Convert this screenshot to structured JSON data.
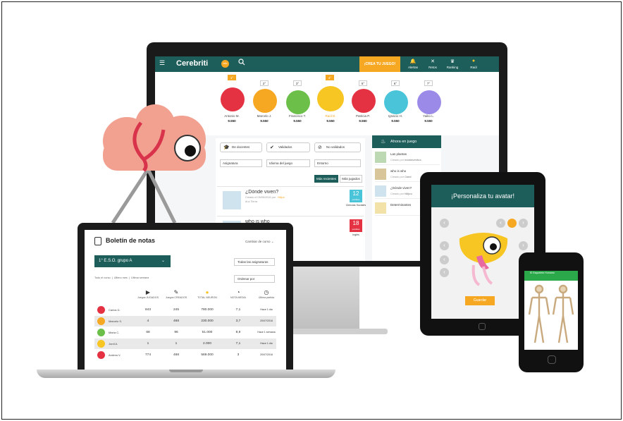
{
  "desktop": {
    "logo": "Cerebriti",
    "logo_badge": "edu",
    "create_button": "¡CREA TU JUEGO!",
    "nav": [
      {
        "label": "Alertas",
        "icon": "bell-icon"
      },
      {
        "label": "Retos",
        "icon": "swords-icon"
      },
      {
        "label": "Ranking",
        "icon": "trophy-icon"
      },
      {
        "label": "Raúl",
        "icon": "user-avatar"
      }
    ],
    "podium": [
      {
        "rank": "1°",
        "name": "Antonio M.",
        "score": "9.550",
        "color": "#e53242"
      },
      {
        "rank": "2°",
        "name": "Marcelo J.",
        "score": "9.550",
        "color": "#f7a823"
      },
      {
        "rank": "3°",
        "name": "Francisco T.",
        "score": "9.550",
        "color": "#6cc04a"
      },
      {
        "rank": "4°",
        "name": "Raúl D.",
        "score": "9.550",
        "color": "#f7c623"
      },
      {
        "rank": "5°",
        "name": "Patricia P.",
        "score": "9.550",
        "color": "#e53242"
      },
      {
        "rank": "6°",
        "name": "Ignacio H.",
        "score": "9.550",
        "color": "#4ac4d8"
      },
      {
        "rank": "7°",
        "name": "Yaiko L.",
        "score": "9.550",
        "color": "#9b8ae8"
      }
    ],
    "filters": {
      "chips": [
        {
          "label": "De docentes",
          "icon": "graduation-cap-icon"
        },
        {
          "label": "Validados",
          "icon": "check-badge-icon"
        },
        {
          "label": "No validados",
          "icon": "no-badge-icon"
        }
      ],
      "selects": [
        "Asignatura",
        "Idioma del juego",
        "Entorno"
      ],
      "tab_recent": "Más recientes",
      "tab_played": "Más jugados"
    },
    "games": [
      {
        "title": "¿Dónde viven?",
        "meta": "Creado el 05/06/2016 por",
        "author": "Ntijuo",
        "tag": "#La Tierra",
        "count": "12",
        "count_label": "partidas",
        "subject": "Ciencias Sociales",
        "badge_color": "#4ac4d8"
      },
      {
        "title": "who is who",
        "count": "18",
        "count_label": "partidas",
        "subject": "Inglés",
        "badge_color": "#e53242"
      }
    ],
    "side": {
      "title": "Ahora en juego",
      "items": [
        {
          "title": "Las plantas",
          "meta": "Creado por",
          "author": "montaventus"
        },
        {
          "title": "who is who",
          "meta": "Creado por",
          "author": "Cand"
        },
        {
          "title": "¿Dónde viven?",
          "meta": "Creado por",
          "author": "Ntijuo"
        },
        {
          "title": "Determinantes",
          "meta": "",
          "author": ""
        }
      ]
    }
  },
  "tablet": {
    "title": "¡Personaliza tu avatar!",
    "button": "Guardar"
  },
  "phone": {
    "header": "El Esqueleto Humano"
  },
  "laptop": {
    "title": "Boletín de notas",
    "course_selector": "Cambiar de curso",
    "group": "1° E.S.O. grupo A",
    "subjects_select": "Todas las asignaturas",
    "periods": [
      "Todo el curso",
      "Último mes",
      "Última semana"
    ],
    "order": "Ordenar por",
    "columns": [
      {
        "label": "Juegos JUGADOS",
        "icon": "play-icon"
      },
      {
        "label": "Juegos CREADOS",
        "icon": "pencil-icon"
      },
      {
        "label": "TOTAL NEURON",
        "icon": "coin-icon"
      },
      {
        "label": "NOTA MEDIA",
        "icon": "gauge-icon"
      },
      {
        "label": "Última partida",
        "icon": "clock-icon"
      }
    ],
    "students": [
      {
        "name": "Carlos D.",
        "played": "843",
        "created": "245",
        "neurons": "780.000",
        "avg": "7,1",
        "last": "Hace 1 día",
        "color": "#e53242"
      },
      {
        "name": "Marcelo S.",
        "played": "4",
        "created": "468",
        "neurons": "230.000",
        "avg": "3,7",
        "last": "20/07/2016",
        "color": "#f7a823"
      },
      {
        "name": "María C.",
        "played": "68",
        "created": "96",
        "neurons": "51.000",
        "avg": "8,9",
        "last": "Hace 1 semana",
        "color": "#6cc04a"
      },
      {
        "name": "Jordi A.",
        "played": "1",
        "created": "1",
        "neurons": "2.000",
        "avg": "7,1",
        "last": "Hace 1 día",
        "color": "#f7c623"
      },
      {
        "name": "Andrea V.",
        "played": "774",
        "created": "468",
        "neurons": "569.000",
        "avg": "3",
        "last": "20/07/2016",
        "color": "#e53242"
      }
    ]
  }
}
